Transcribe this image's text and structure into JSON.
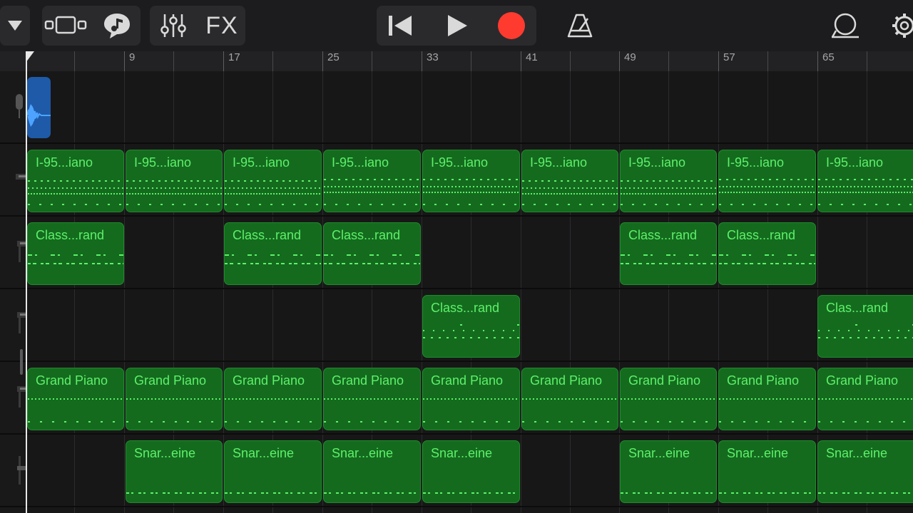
{
  "toolbar": {
    "fx_label": "FX",
    "icons": [
      "dropdown-triangle-icon",
      "browser-view-icon",
      "loop-browser-icon",
      "mixer-icon",
      "fx-icon",
      "go-to-start-icon",
      "play-icon",
      "record-icon",
      "metronome-icon",
      "master-track-icon",
      "settings-gear-icon"
    ],
    "colors": {
      "record": "#ff3b30",
      "toolbar_bg": "#1c1c1e"
    }
  },
  "ruler": {
    "labels": [
      "9",
      "17",
      "25",
      "33",
      "41",
      "49",
      "57",
      "65"
    ]
  },
  "tracks": [
    {
      "instrument_icon": "audio-recorder-icon",
      "regions": []
    },
    {
      "instrument_icon": "keyboard-instrument-icon",
      "regions": [
        "I-95...iano",
        "I-95...iano",
        "I-95...iano",
        "I-95...iano",
        "I-95...iano",
        "I-95...iano",
        "I-95...iano",
        "I-95...iano",
        "I-95...iano"
      ]
    },
    {
      "instrument_icon": "keyboard-instrument-icon",
      "regions": [
        "Class...rand",
        "Class...rand",
        "Class...rand",
        "Class...rand",
        "Class...rand"
      ]
    },
    {
      "instrument_icon": "keyboard-instrument-icon",
      "regions": [
        "Class...rand",
        "Clas...rand"
      ]
    },
    {
      "instrument_icon": "keyboard-instrument-icon",
      "regions": [
        "Grand Piano",
        "Grand Piano",
        "Grand Piano",
        "Grand Piano",
        "Grand Piano",
        "Grand Piano",
        "Grand Piano",
        "Grand Piano",
        "Grand Piano"
      ]
    },
    {
      "instrument_icon": "drum-kit-icon",
      "regions": [
        "Snar...eine",
        "Snar...eine",
        "Snar...eine",
        "Snar...eine",
        "Snar...eine",
        "Snar...eine",
        "Snar...eine"
      ]
    }
  ],
  "colors": {
    "midi_region": "#146b1e",
    "midi_text": "#5ef06a",
    "audio_region": "#1e5aa8"
  }
}
